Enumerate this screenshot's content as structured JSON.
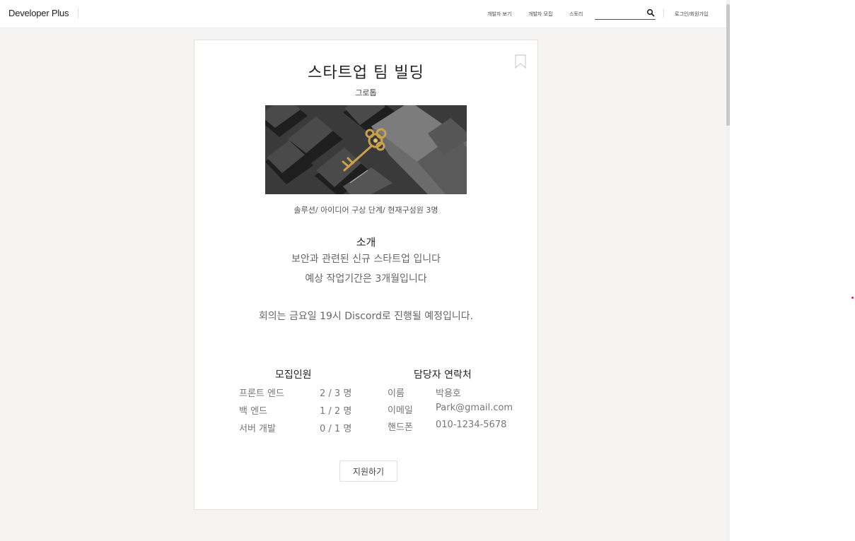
{
  "nav": {
    "brand": "Developer Plus",
    "links": [
      "개발자 보기",
      "개발자 모집",
      "스토리"
    ],
    "search_value": "",
    "login": "로그인/회원가입"
  },
  "post": {
    "title": "스타트업 팀 빌딩",
    "category": "그로톱",
    "meta": "솔루션/ 아이디어 구상 단계/ 현재구성원 3명",
    "intro_heading": "소개",
    "intro_lines": [
      "보안과 관련된 신규 스타트업 입니다",
      "예상 작업기간은 3개월입니다",
      "회의는 금요일 19시 Discord로 진행될 예정입니다."
    ],
    "recruit": {
      "heading": "모집인원",
      "rows": [
        {
          "role": "프론트 엔드",
          "count": "2 / 3 명"
        },
        {
          "role": "백 엔드",
          "count": "1 / 2 명"
        },
        {
          "role": "서버 개발",
          "count": "0 / 1 명"
        }
      ]
    },
    "contact": {
      "heading": "담당자 연락처",
      "rows": [
        {
          "label": "이름",
          "value": "박용호"
        },
        {
          "label": "이메일",
          "value": "Park@gmail.com"
        },
        {
          "label": "핸드폰",
          "value": "010-1234-5678"
        }
      ]
    },
    "apply_label": "지원하기"
  },
  "icons": [
    "search-icon",
    "bookmark-icon"
  ]
}
